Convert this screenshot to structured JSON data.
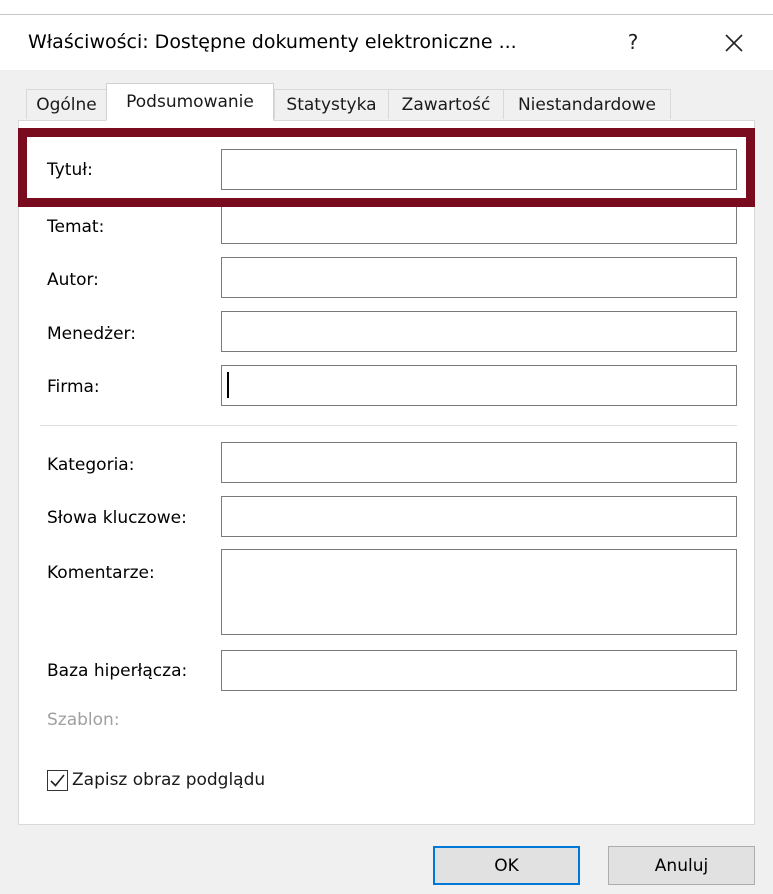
{
  "window": {
    "title": "Właściwości: Dostępne dokumenty elektroniczne ...",
    "help_label": "?"
  },
  "tabs": [
    {
      "label": "Ogólne",
      "active": false
    },
    {
      "label": "Podsumowanie",
      "active": true
    },
    {
      "label": "Statystyka",
      "active": false
    },
    {
      "label": "Zawartość",
      "active": false
    },
    {
      "label": "Niestandardowe",
      "active": false
    }
  ],
  "fields": {
    "title": {
      "label": "Tytuł:",
      "value": ""
    },
    "subject": {
      "label": "Temat:",
      "value": ""
    },
    "author": {
      "label": "Autor:",
      "value": ""
    },
    "manager": {
      "label": "Menedżer:",
      "value": ""
    },
    "company": {
      "label": "Firma:",
      "value": ""
    },
    "category": {
      "label": "Kategoria:",
      "value": ""
    },
    "keywords": {
      "label": "Słowa kluczowe:",
      "value": ""
    },
    "comments": {
      "label": "Komentarze:",
      "value": ""
    },
    "hyperlink_base": {
      "label": "Baza hiperłącza:",
      "value": ""
    },
    "template": {
      "label": "Szablon:"
    }
  },
  "save_preview": {
    "label": "Zapisz obraz podglądu",
    "checked": true
  },
  "buttons": {
    "ok": "OK",
    "cancel": "Anuluj"
  },
  "colors": {
    "highlight": "#7a0b1e",
    "default_button_border": "#0078d7"
  }
}
